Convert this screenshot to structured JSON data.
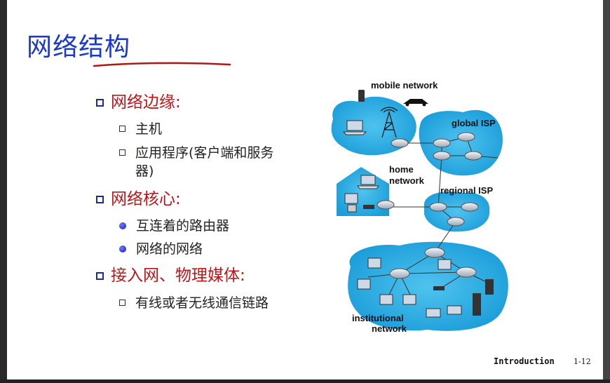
{
  "slide": {
    "title": "网络结构",
    "bullets": [
      {
        "label": "网络边缘:"
      },
      {
        "label": "主机"
      },
      {
        "label": "应用程序(客户端和服务"
      },
      {
        "label": "器)"
      },
      {
        "label": "网络核心:"
      },
      {
        "label": "互连着的路由器"
      },
      {
        "label": "网络的网络"
      },
      {
        "label": "接入网、物理媒体:"
      },
      {
        "label": "有线或者无线通信链路"
      }
    ],
    "diagram_labels": {
      "mobile": "mobile network",
      "global": "global ISP",
      "home1": "home",
      "home2": "network",
      "regional": "regional ISP",
      "inst1": "institutional",
      "inst2": "network"
    },
    "footer": {
      "section": "Introduction",
      "page": "1-12"
    }
  },
  "colors": {
    "title": "#1c39c8",
    "level1": "#c0141a",
    "level2": "#222222",
    "network_fill": "#2ab3e6",
    "underline": "#b01818"
  }
}
